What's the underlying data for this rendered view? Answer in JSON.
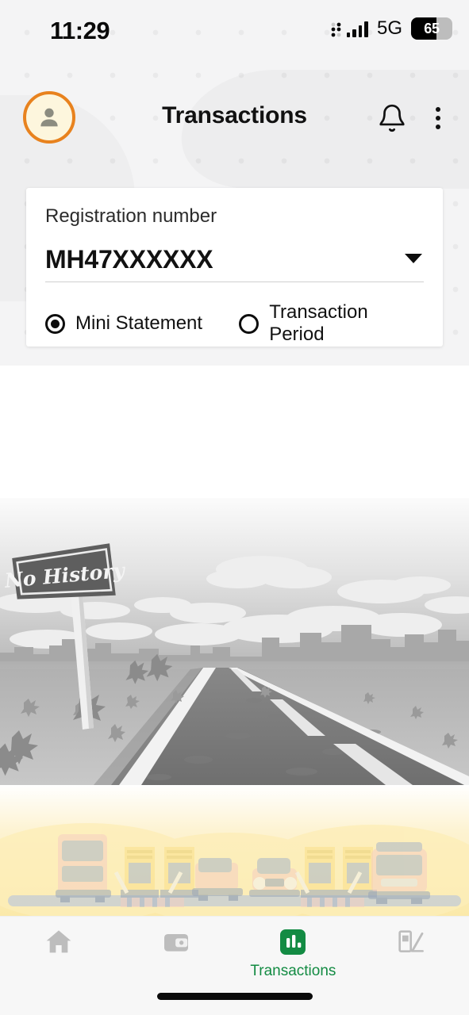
{
  "status_bar": {
    "time": "11:29",
    "network": "5G",
    "battery_percent": "65",
    "signal_icon": "signal-bars-icon",
    "battery_icon": "battery-icon"
  },
  "header": {
    "title": "Transactions",
    "avatar_icon": "user-avatar-icon",
    "notification_icon": "bell-icon",
    "menu_icon": "kebab-menu-icon",
    "accent_orange": "#e8821e"
  },
  "card": {
    "label": "Registration number",
    "selected_value": "MH47XXXXXX",
    "dropdown_icon": "chevron-down-icon",
    "options": [
      {
        "label": "Mini Statement",
        "selected": true
      },
      {
        "label": "Transaction Period",
        "selected": false
      }
    ]
  },
  "empty_state": {
    "sign_text": "No History",
    "illustration": "empty-road-with-signboard",
    "footer_illustration": "vehicles-at-toll-plaza"
  },
  "bottom_nav": {
    "active_color": "#138b43",
    "items": [
      {
        "name": "home",
        "icon": "home-icon",
        "label": "",
        "active": false
      },
      {
        "name": "wallet",
        "icon": "wallet-icon",
        "label": "",
        "active": false
      },
      {
        "name": "transactions",
        "icon": "bar-chart-icon",
        "label": "Transactions",
        "active": true
      },
      {
        "name": "toll-plaza",
        "icon": "toll-booth-icon",
        "label": "",
        "active": false
      }
    ],
    "home_indicator": "home-indicator-bar"
  }
}
